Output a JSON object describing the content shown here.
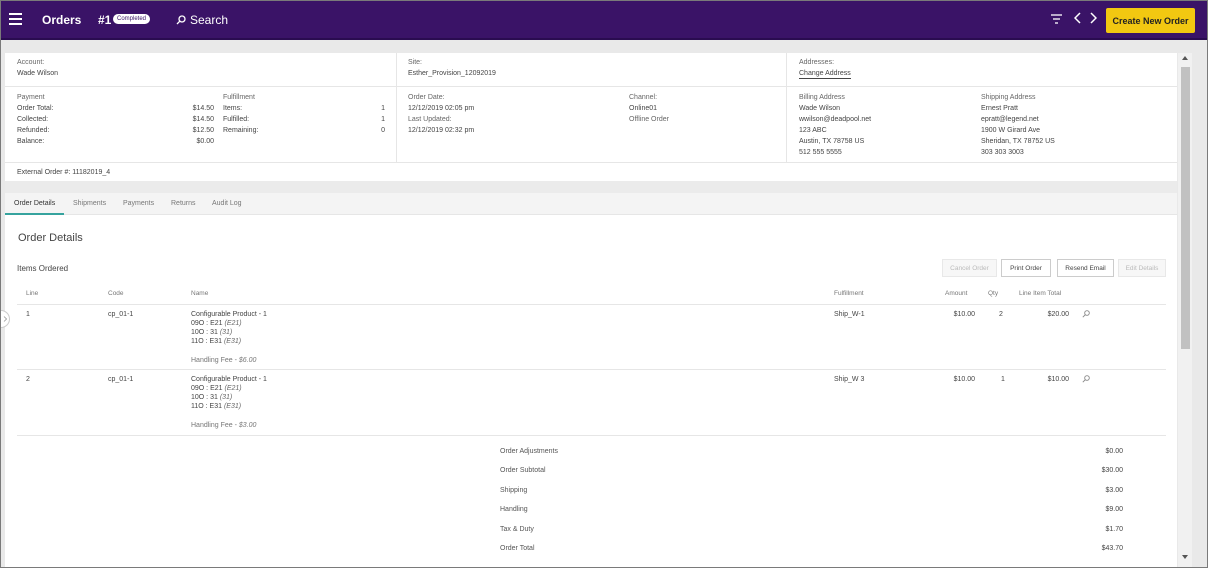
{
  "header": {
    "title": "Orders",
    "order_number": "#1",
    "status_badge": "Completed",
    "search_label": "Search",
    "create_button": "Create New Order"
  },
  "summary": {
    "account_label": "Account:",
    "account_value": "Wade Wilson",
    "site_label": "Site:",
    "site_value": "Esther_Provision_12092019",
    "addresses_label": "Addresses:",
    "change_address": "Change Address",
    "payment": {
      "title": "Payment",
      "rows": [
        {
          "label": "Order Total:",
          "value": "$14.50"
        },
        {
          "label": "Collected:",
          "value": "$14.50"
        },
        {
          "label": "Refunded:",
          "value": "$12.50"
        },
        {
          "label": "Balance:",
          "value": "$0.00"
        }
      ]
    },
    "fulfillment": {
      "title": "Fulfillment",
      "rows": [
        {
          "label": "Items:",
          "value": "1"
        },
        {
          "label": "Fulfilled:",
          "value": "1"
        },
        {
          "label": "Remaining:",
          "value": "0"
        }
      ]
    },
    "order_date_label": "Order Date:",
    "order_date_value": "12/12/2019 02:05 pm",
    "last_updated_label": "Last Updated:",
    "last_updated_value": "12/12/2019 02:32 pm",
    "channel_label": "Channel:",
    "channel_value": "Online01",
    "channel_extra": "Offline Order",
    "billing": {
      "title": "Billing Address",
      "lines": [
        "Wade Wilson",
        "wwilson@deadpool.net",
        "123 ABC",
        "Austin, TX 78758 US",
        "512 555 5555"
      ]
    },
    "shipping": {
      "title": "Shipping Address",
      "lines": [
        "Ernest Pratt",
        "epratt@legend.net",
        "1900 W Girard Ave",
        "Sheridan, TX 78752 US",
        "303 303 3003"
      ]
    },
    "external_order": "External Order #: 11182019_4"
  },
  "tabs": [
    "Order Details",
    "Shipments",
    "Payments",
    "Returns",
    "Audit Log"
  ],
  "main": {
    "title": "Order Details",
    "items_title": "Items Ordered",
    "buttons": {
      "cancel": "Cancel Order",
      "print": "Print Order",
      "resend": "Resend Email",
      "edit": "Edit Details"
    },
    "columns": [
      "Line",
      "Code",
      "Name",
      "Fulfillment",
      "Amount",
      "Qty",
      "Line Item Total"
    ],
    "items": [
      {
        "line": "1",
        "code": "cp_01-1",
        "name": "Configurable Product - 1",
        "options": [
          {
            "key": "09O : E21",
            "detail": "(E21)"
          },
          {
            "key": "10O : 31",
            "detail": "(31)"
          },
          {
            "key": "11O : E31",
            "detail": "(E31)"
          }
        ],
        "fee_label": "Handling Fee - ",
        "fee_value": "$6.00",
        "fulfillment": "Ship_W-1",
        "amount": "$10.00",
        "qty": "2",
        "total": "$20.00"
      },
      {
        "line": "2",
        "code": "cp_01-1",
        "name": "Configurable Product - 1",
        "options": [
          {
            "key": "09O : E21",
            "detail": "(E21)"
          },
          {
            "key": "10O : 31",
            "detail": "(31)"
          },
          {
            "key": "11O : E31",
            "detail": "(E31)"
          }
        ],
        "fee_label": "Handling Fee - ",
        "fee_value": "$3.00",
        "fulfillment": "Ship_W 3",
        "amount": "$10.00",
        "qty": "1",
        "total": "$10.00"
      }
    ],
    "totals": [
      {
        "label": "Order Adjustments",
        "value": "$0.00"
      },
      {
        "label": "Order Subtotal",
        "value": "$30.00"
      },
      {
        "label": "Shipping",
        "value": "$3.00"
      },
      {
        "label": "Handling",
        "value": "$9.00"
      },
      {
        "label": "Tax & Duty",
        "value": "$1.70"
      },
      {
        "label": "Order Total",
        "value": "$43.70"
      }
    ]
  },
  "colors": {
    "header_bg": "#3a1367",
    "create_button_bg": "#f2c811",
    "tab_accent": "#36a39e"
  }
}
